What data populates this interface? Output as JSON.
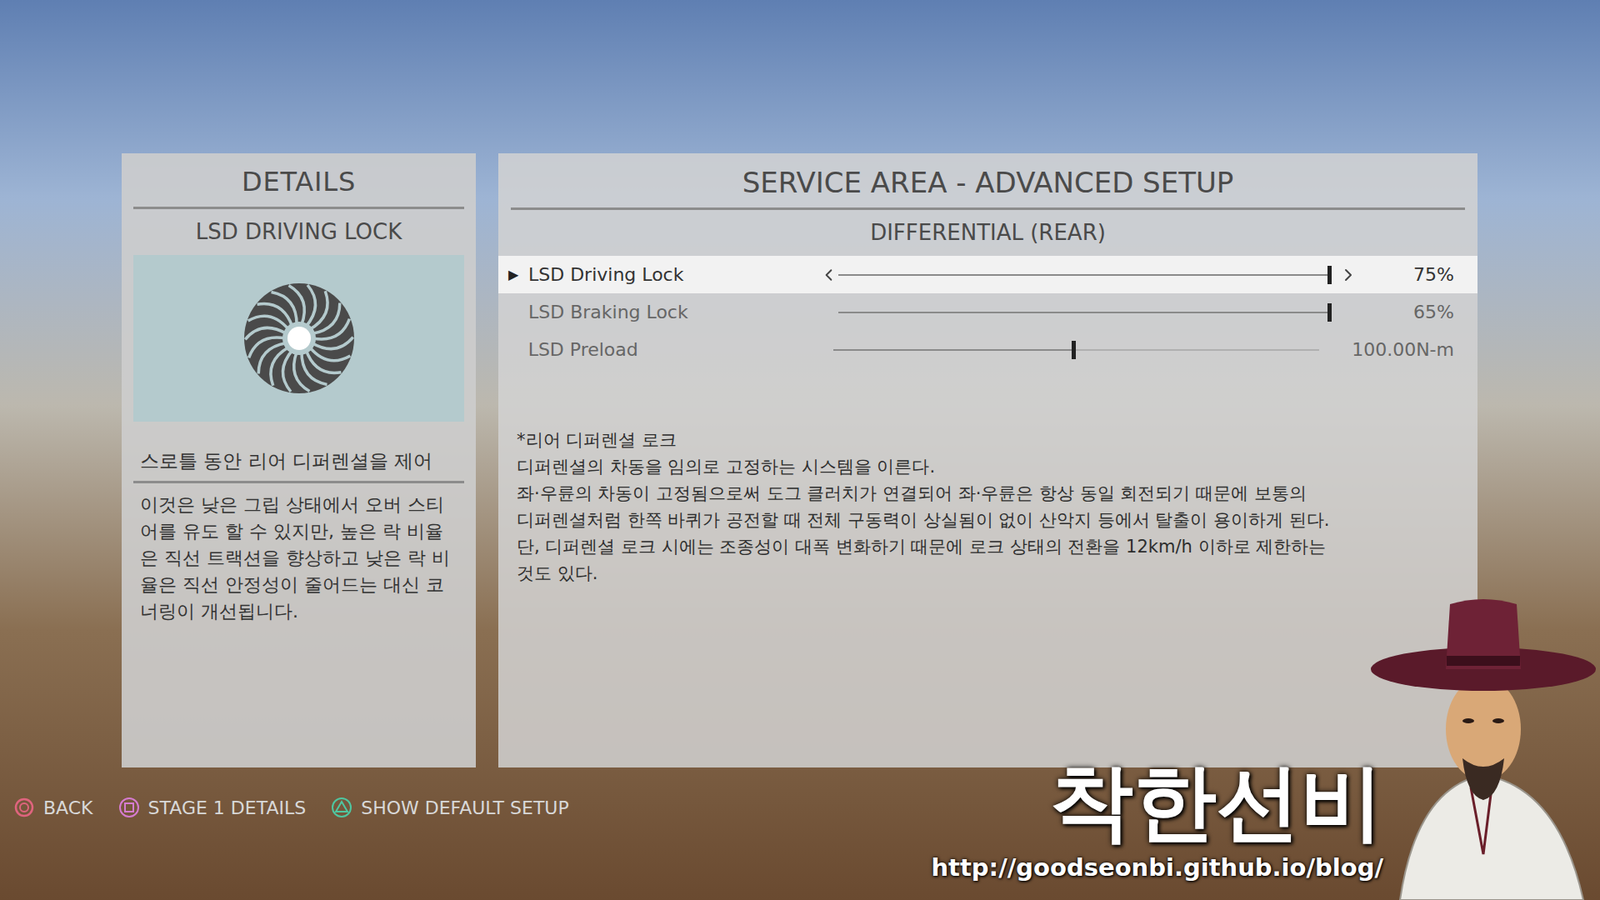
{
  "details": {
    "title": "DETAILS",
    "subtitle": "LSD DRIVING LOCK",
    "summary": "스로틀 동안 리어 디퍼렌셜을 제어",
    "description": "이것은 낮은 그립 상태에서 오버 스티어를 유도 할 수 있지만, 높은 락 비율은 직선 트랙션을 향상하고 낮은 락 비율은 직선 안정성이 줄어드는 대신 코너링이 개선됩니다."
  },
  "setup": {
    "title": "SERVICE AREA - ADVANCED SETUP",
    "section": "DIFFERENTIAL (REAR)",
    "marker": "▶",
    "rows": [
      {
        "label": "LSD Driving Lock",
        "selected": true,
        "level": 1,
        "value": "75%"
      },
      {
        "label": "LSD Braking Lock",
        "selected": false,
        "level": 1,
        "value": "65%"
      },
      {
        "label": "LSD Preload",
        "selected": false,
        "level": 0.5,
        "value": "100.00N-m"
      }
    ]
  },
  "note": {
    "lines": [
      "*리어 디퍼렌셜 로크",
      "디퍼렌셜의 차동을 임의로 고정하는 시스템을 이른다.",
      "좌·우륜의 차동이 고정됨으로써 도그 클러치가 연결되어 좌·우륜은 항상 동일 회전되기 때문에 보통의",
      "디퍼렌셜처럼 한쪽 바퀴가 공전할 때 전체 구동력이 상실됨이 없이 산악지 등에서 탈출이 용이하게 된다.",
      "단, 디퍼렌셜 로크 시에는 조종성이 대폭 변화하기 때문에 로크 상태의 전환을 12km/h 이하로 제한하는",
      "것도 있다."
    ]
  },
  "footer": {
    "buttons": [
      {
        "label": "BACK",
        "kind": "circle",
        "color": "#e0647e"
      },
      {
        "label": "STAGE 1 DETAILS",
        "kind": "square",
        "color": "#d67bd0"
      },
      {
        "label": "SHOW DEFAULT SETUP",
        "kind": "triangle",
        "color": "#4fc6a0"
      }
    ]
  },
  "watermark": {
    "name": "착한선비",
    "url": "http://goodseonbi.github.io/blog/"
  }
}
